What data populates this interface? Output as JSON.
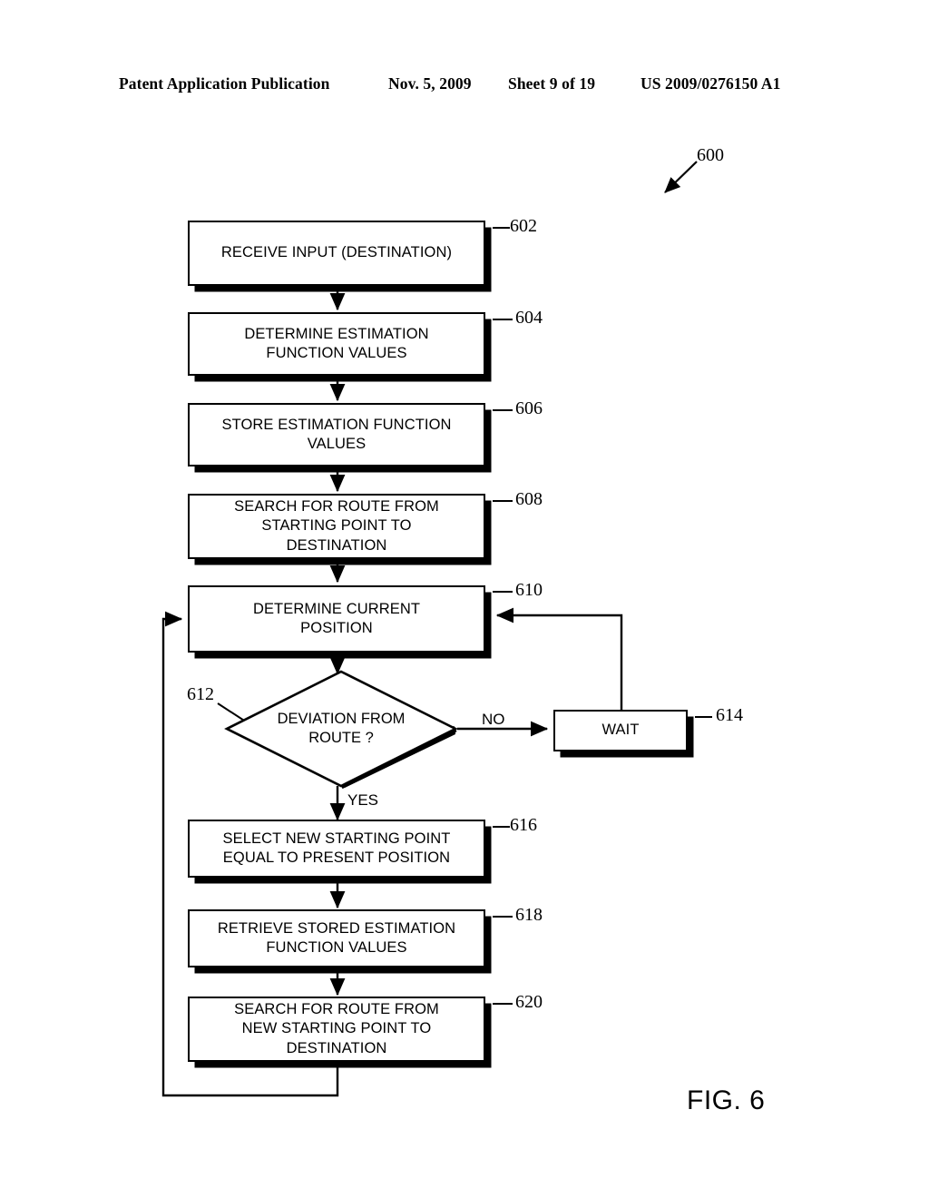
{
  "header": {
    "publication": "Patent Application Publication",
    "date": "Nov. 5, 2009",
    "sheet": "Sheet 9 of 19",
    "patent_number": "US 2009/0276150 A1"
  },
  "figure": {
    "caption": "FIG. 6",
    "diagram_ref": "600"
  },
  "flowchart": {
    "nodes": [
      {
        "ref": "602",
        "type": "process",
        "label": "RECEIVE INPUT (DESTINATION)"
      },
      {
        "ref": "604",
        "type": "process",
        "label": "DETERMINE ESTIMATION\nFUNCTION VALUES"
      },
      {
        "ref": "606",
        "type": "process",
        "label": "STORE ESTIMATION FUNCTION\nVALUES"
      },
      {
        "ref": "608",
        "type": "process",
        "label": "SEARCH FOR ROUTE FROM\nSTARTING POINT TO\nDESTINATION"
      },
      {
        "ref": "610",
        "type": "process",
        "label": "DETERMINE CURRENT\nPOSITION"
      },
      {
        "ref": "612",
        "type": "decision",
        "label": "DEVIATION FROM\nROUTE ?"
      },
      {
        "ref": "614",
        "type": "process",
        "label": "WAIT"
      },
      {
        "ref": "616",
        "type": "process",
        "label": "SELECT NEW STARTING POINT\nEQUAL TO PRESENT POSITION"
      },
      {
        "ref": "618",
        "type": "process",
        "label": "RETRIEVE STORED ESTIMATION\nFUNCTION VALUES"
      },
      {
        "ref": "620",
        "type": "process",
        "label": "SEARCH FOR ROUTE FROM\nNEW STARTING POINT TO\nDESTINATION"
      }
    ],
    "edge_labels": {
      "no": "NO",
      "yes": "YES"
    }
  },
  "colors": {
    "ink": "#000000",
    "paper": "#ffffff"
  }
}
